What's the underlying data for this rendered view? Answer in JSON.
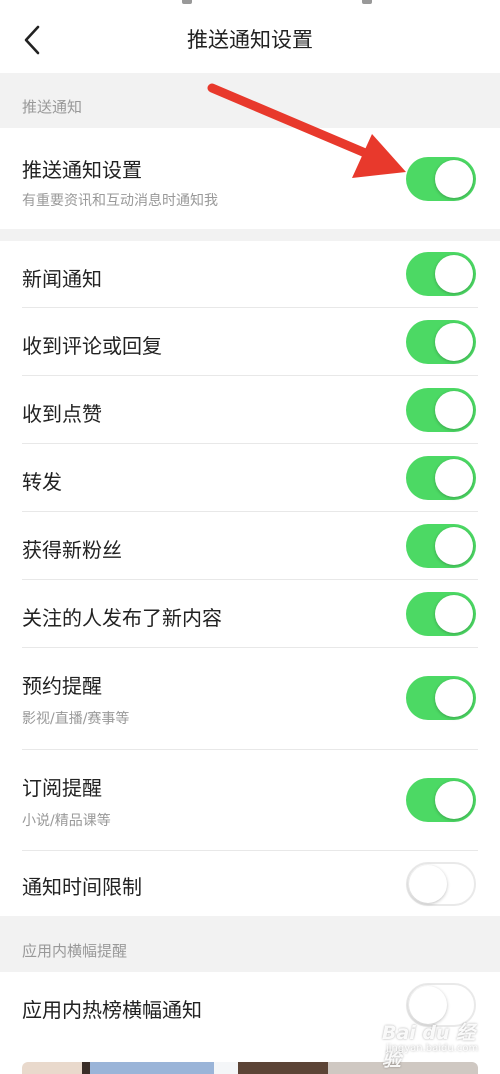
{
  "header": {
    "title": "推送通知设置",
    "back_icon": "back-arrow-icon"
  },
  "sections": {
    "push": {
      "label": "推送通知"
    },
    "banner": {
      "label": "应用内横幅提醒"
    }
  },
  "push_setting": {
    "title": "推送通知设置",
    "subtitle": "有重要资讯和互动消息时通知我",
    "enabled": true
  },
  "notifications": [
    {
      "title": "新闻通知",
      "enabled": true
    },
    {
      "title": "收到评论或回复",
      "enabled": true
    },
    {
      "title": "收到点赞",
      "enabled": true
    },
    {
      "title": "转发",
      "enabled": true
    },
    {
      "title": "获得新粉丝",
      "enabled": true
    },
    {
      "title": "关注的人发布了新内容",
      "enabled": true
    },
    {
      "title": "预约提醒",
      "subtitle": "影视/直播/赛事等",
      "enabled": true
    },
    {
      "title": "订阅提醒",
      "subtitle": "小说/精品课等",
      "enabled": true
    },
    {
      "title": "通知时间限制",
      "enabled": false
    }
  ],
  "banner_setting": {
    "title": "应用内热榜横幅通知",
    "enabled": false
  },
  "annotation": {
    "arrow_icon": "red-pointer-arrow-icon",
    "color": "#e8392c"
  },
  "colors": {
    "toggle_on": "#4cd964",
    "background": "#f2f2f2"
  },
  "watermark": {
    "main": "Bai du 经验",
    "sub": "jingyan.baidu.com"
  }
}
